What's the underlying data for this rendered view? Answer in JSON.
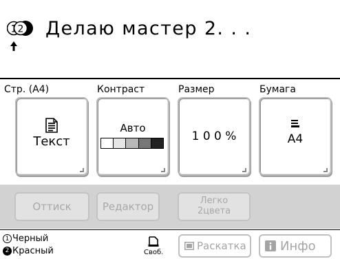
{
  "status": {
    "drum1": "1",
    "drum2": "2",
    "message": "Делаю мастер 2. . ."
  },
  "columns": {
    "page": "Стр. (А4)",
    "contrast": "Контраст",
    "size": "Размер",
    "paper": "Бумага"
  },
  "buttons": {
    "page_value": "Текст",
    "contrast_value": "Авто",
    "contrast_levels": [
      "#ffffff",
      "#e6e6e6",
      "#b8b8b8",
      "#777777",
      "#222222"
    ],
    "size_value": "1 0 0 %",
    "paper_value": "А4"
  },
  "actions": {
    "print": "Оттиск",
    "editor": "Редактор",
    "easy_line1": "Легко",
    "easy_line2": "2цвета"
  },
  "bottom": {
    "ink1_num": "1",
    "ink1": "Черный",
    "ink2_num": "2",
    "ink2": "Красный",
    "free": "Своб.",
    "roll": "Раскатка",
    "info": "Инфо"
  },
  "colors": {
    "strip": "#d2d2d2",
    "disabled_text": "#a8a8a8"
  }
}
